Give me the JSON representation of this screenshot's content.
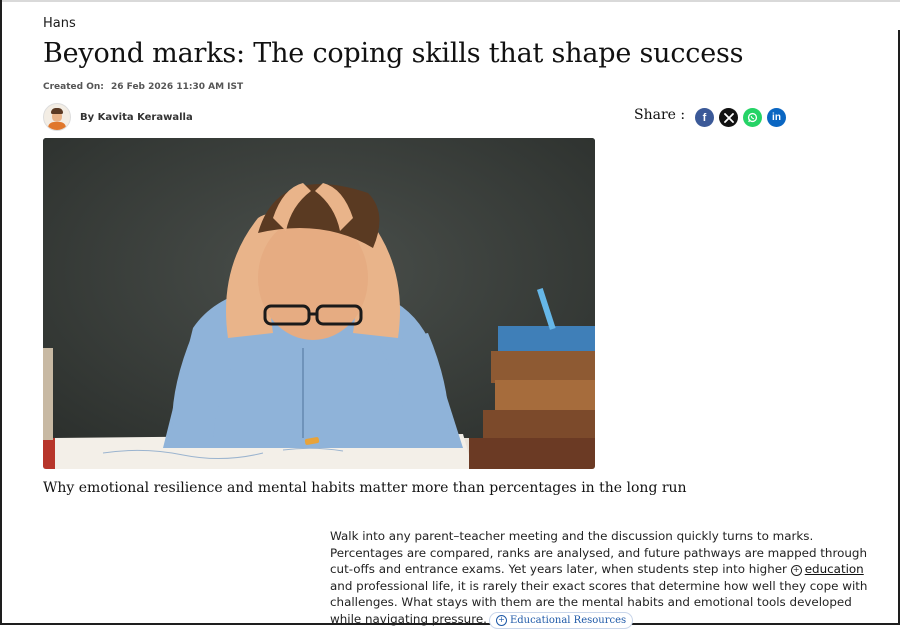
{
  "article": {
    "source": "Hans",
    "headline": "Beyond marks: The coping skills that shape success",
    "created_label": "Created On:",
    "created_value": "26 Feb 2026 11:30 AM IST",
    "byline": "By Kavita Kerawalla",
    "caption": "Why emotional resilience and mental habits matter more than percentages in the long run",
    "body_before_link": "Walk into any parent–teacher meeting and the discussion quickly turns to marks. Percentages are compared, ranks are analysed, and future pathways are mapped through cut-offs and entrance exams. Yet years later, when students step into higher ",
    "inline_link": "education",
    "body_after_link": " and professional life, it is rarely their exact scores that determine how well they cope with challenges. What stays with them are the mental habits and emotional tools developed while navigating pressure.",
    "tag_chip": "Educational Resources"
  },
  "share": {
    "label": "Share :",
    "icons": [
      {
        "name": "facebook-icon",
        "glyph": "f",
        "color": "#3b5998"
      },
      {
        "name": "x-icon",
        "glyph": "X",
        "color": "#111111"
      },
      {
        "name": "whatsapp-icon",
        "glyph": "✆",
        "color": "#25d366"
      },
      {
        "name": "linkedin-icon",
        "glyph": "in",
        "color": "#0a66c2"
      }
    ]
  },
  "image": {
    "subject": "boy-with-hands-on-head-icon"
  }
}
